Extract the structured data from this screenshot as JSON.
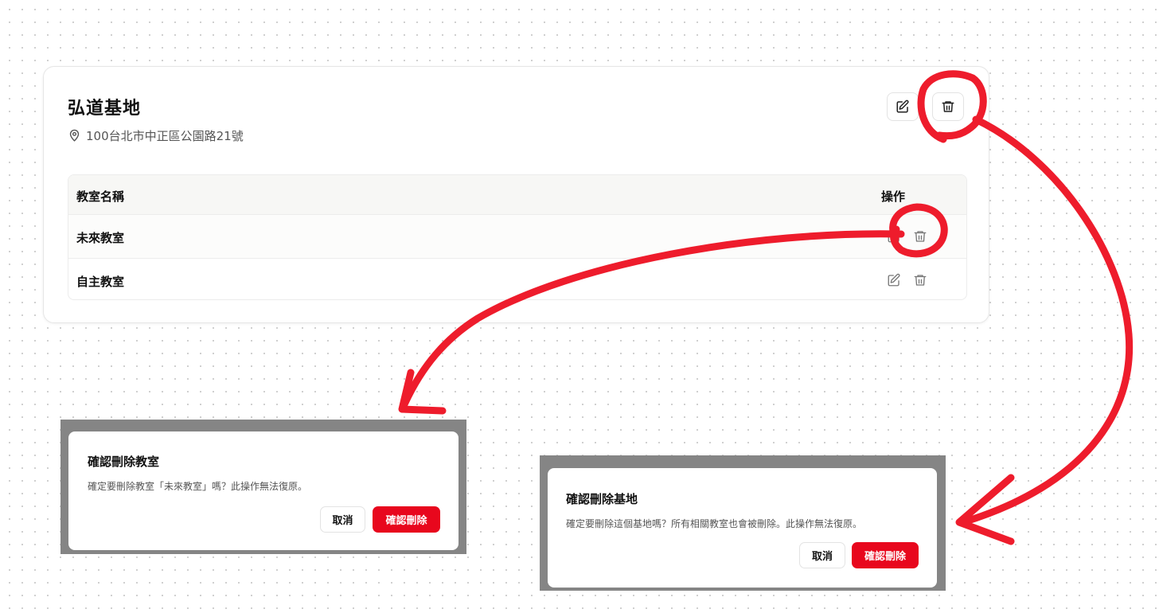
{
  "base": {
    "name": "弘道基地",
    "address": "100台北市中正區公園路21號"
  },
  "table": {
    "headers": [
      "教室名稱",
      "操作"
    ],
    "rows": [
      {
        "name": "未來教室"
      },
      {
        "name": "自主教室"
      }
    ]
  },
  "dialog_classroom": {
    "title": "確認刪除教室",
    "description": "確定要刪除教室「未來教室」嗎？此操作無法復原。",
    "cancel_label": "取消",
    "confirm_label": "確認刪除"
  },
  "dialog_base": {
    "title": "確認刪除基地",
    "description": "確定要刪除這個基地嗎？所有相關教室也會被刪除。此操作無法復原。",
    "cancel_label": "取消",
    "confirm_label": "確認刪除"
  },
  "icons": {
    "location": "map-pin-icon",
    "edit": "pencil-square-icon",
    "delete": "trash-icon"
  },
  "colors": {
    "danger": "#e8071d",
    "annotation": "#ee1c2c",
    "overlay": "#858585"
  }
}
